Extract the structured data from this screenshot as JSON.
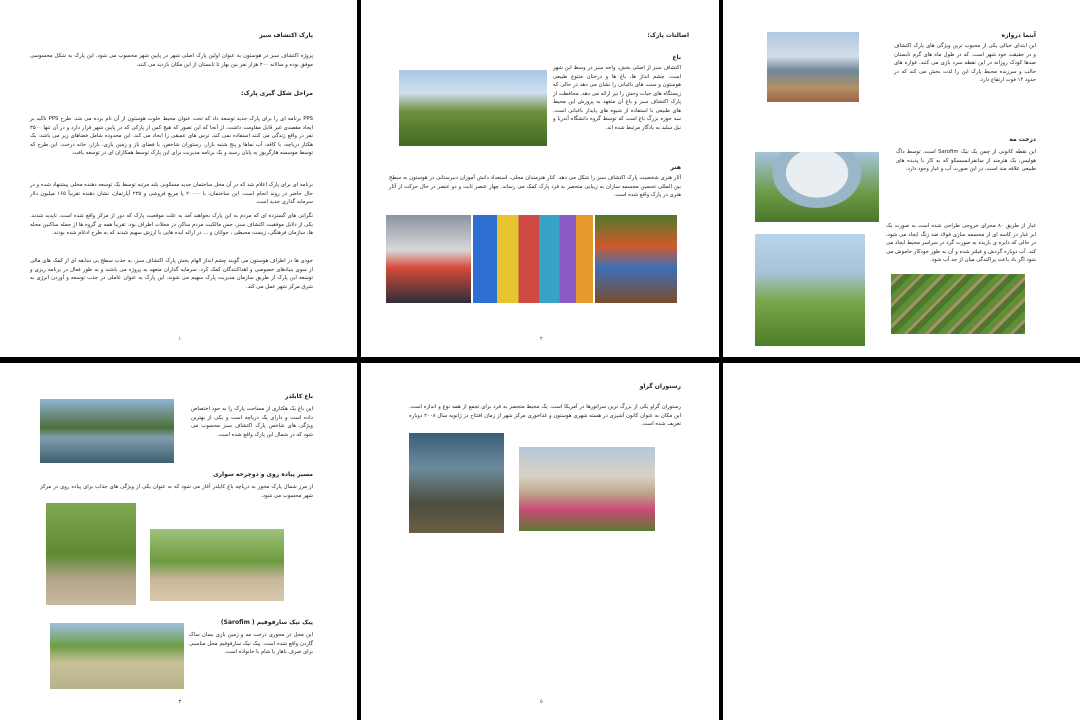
{
  "pages": [
    {
      "num": "١",
      "title": "پارک اکتشاف سبز",
      "intro": "پروژه اکتشاف سبز در هوستون به عنوان اولین پارک اصلی شهر در پایین شهر محسوب می شود. این پارک به شکل محسوسی موفق بوده و سالانه ۲۰۰ هزار نفر بین بهار تا تابستان از این مکان بازدید می کنند.",
      "h2": "مراحل شکل گیری پارک:",
      "paras": [
        "PPS برنامه ای را برای پارک جدید توسعه داد که تحت عنوان محیط خلوت هوستون از آن نام برده می شد. طرح PPS تاکید بر ایجاد مقصدی غیر قابل مقاومت داشت، از آنجا که این تصور که هیچ کس از پارکی که در پایین شهر قرار دارد و در آن تنها ۳۵۰۰ نفر در واقع زندگی می کنند استفاده نمی کند، ترس های عمیقی را ایجاد می کند. این محدوده شامل فضاهای زیر می باشد: یک هکتار دریاچه، با کافه، آب نماها و پنج شنبه بازار، رستوران شاخص، با فضای باز و زمین بازی، بازار، خانه درخت. این طرح که توسط موسسه هارگریوز به پایان رسید و یک برنامه مدیریت برای این پارک توسط همکاران ای در توسعه یافت.",
        "برنامه ای برای پارک اعلام شد که در آن محل ساختمان جدید مسکونی بلند مرتبه توسط یک توسعه دهنده محلی پیشنهاد شده و در حال حاضر در روند انجام است. این ساختمان، با ۲۰۰۰۰ پا مربع فروشی و ۲۳۵ آپارتمان، نشان دهنده تقریباً ۱۶۵ میلیون دلار سرمایه گذاری جدید است.",
        "نگرانی های گسترده ای که مردم به این پارک نخواهند آمد به علت موقعیت پارک که دور از مرکز واقع شده است، ناپدید شدند. یکی از دلایل موفقیت اکتشاف سبز، حس مالکیت مردم ساکن در محلات اطراف بود. تقریباً همه ی گروه ها از جمله ساکنین محله ها، سازمان فرهنگی، زیست محیطی ، جوانان و ... در ارائه ایده هایی با ارزش سهیم شدند که به طرح ادغام شده بودند.",
        "خودی ها در اطراف هوستون می گویند چشم انداز الهام بخش پارک اکتشاف سبز، به جذب سطح بی سابقه ای از کمک های مالی از سوی بنیادهای خصوصی و اهداکنندگان کمک کرد. سرمایه گذاران متعهد به پروژه می باشند و به طور فعال در برنامه ریزی و توسعه این پارک از طریق سازمان مدیریت پارک سهیم می شوند. این پارک به عنوان عاملی در جذب توسعه و آوردن انرژی به شرق مرکز شهر عمل می کند."
      ]
    },
    {
      "num": "٢",
      "title": "اصالتات پارک:",
      "h1": "باغ",
      "p1": "اکتشاف سبز از اصلی بخش، واحه سبز در وسط این شهر است. چشم انداز ها، باغ ها و درختان متنوع طبیعی هوستون و سنت های باغبانی را نشان می دهد در حالی که زیستگاه های حیات وحش را نیز ارائه می دهد. محافظت از پارک اکتشاف سبز و باغ آن متعهد به پرورش این محیط های طبیعی با استفاده از شیوه های پایدار باغبانی است. سه حوزه بزرگ باغ است که توسط گروه دانشگاه آندریا و نیل سلید به یادگار مرتبط شده اند.",
      "h2": "هنر",
      "p2": "آثار هنری شخصیت پارک اکتشاف سبز را شکل می دهد. کنار هنرمندان محلی، استعداد دانش آموزان دبیرستانی در هوستون به سطح بین المللی تحسین مجسمه سازان به زیبایی متحصر به فرد پارک کمک می رساند. چهار عنصر ثابت و دو عنصر در حال حرکت از آثار هنری در پارک واقع شده است."
    },
    {
      "num": "",
      "h1": "آبنما دروازه",
      "p1": "این ابتدای خیالی یکی از محبوب ترین ویژگی های پارک اکتشاف و در حقیقت خود شهر است. که در طول ماه های گرم تابستان صدها کودک روزانه در این نقطه سرد بازی می کنند. فواره های جالب و سرزنده محیط پارک این را لذت بخش می کند که در حدود ۱۴ فوت ارتفاع دارد.",
      "h2": "درخت مه",
      "p2": "این نقطه کانونی از چمن یک نیک Sarofim است، توسط داگ هولیس، یک هنرمند از سانفرانسیسکو که به کار با پدیده های طبیعی علاقه مند است، در این صورت آب و غبار وجود دارد.",
      "p3": "غبار از طریق ۸۰ مجرای خروجی طراحی شده است به صورت یک ابر غبار در کاسه ای از مجسمه سازی فولاد ضد زنگ ایجاد می شود، در حالی که دایره ی باریده به صورت گرد در سراسر محیط ایجاد می کند. آب دوباره گردش و فیلتر شده و آن به طور خودکار خاموش می شود اگر باد باعث پراکندگی میان از حد آب شود."
    },
    {
      "num": "٣",
      "h1": "باغ کایلدر",
      "p1": "این باغ یک هکتاری از مساحت پارک را به خود اختصاص داده است و دارای یک دریاچه است و یکی از بهترین ویژگی های شاخص پارک اکتشاف سبز محسوب می شود که در شمال این پارک واقع شده است.",
      "h2": "مسیر پیاده روی و دوچرخه سواری",
      "p2": "از مرز شمال پارک محور به دریاچه باغ کایلدر آغاز می شود که به عنوان یکی از ویژگی های جذاب برای پیاده روی در مرکز شهر محسوب می شود.",
      "h3": "پیک نیک سارفوفیم ( Sarofim)",
      "p3": "این محل در محوری درخت مه و زمین بازی بسان ساک گاردن واقع شده است. پیک نیک سارفوفیم محل مناسبی برای صرف ناهار یا شام با خانواده است."
    },
    {
      "num": "٥",
      "h1": "رستوران گراو",
      "p1": "رستوران گراو یکی از بزرگ ترین سراتورها در آمریکا است. یک محیط متحصر به فرد برای تجمع از همه نوع و اندازه است. این مکان به عنوان کانون آشپزی در هسته شهری هوستون و غذاخوری مرکز شهر از زمان افتتاح در ژانویه سال ۲۰۰۸ دوباره تعریف شده است."
    }
  ],
  "images": {
    "p2_garden": "garden-photo",
    "p2_art": [
      "sculpture-photo",
      "color-blocks-photo",
      "art-car-photo"
    ],
    "p3": [
      "fountain-photo",
      "mist-tree-photo",
      "lawn-photo",
      "garden-beds-photo"
    ],
    "p4": [
      "pond-photo",
      "cyclist-photo",
      "walkway-photo",
      "picnic-photo"
    ],
    "p5": [
      "cafe-photo",
      "grove-photo"
    ]
  }
}
